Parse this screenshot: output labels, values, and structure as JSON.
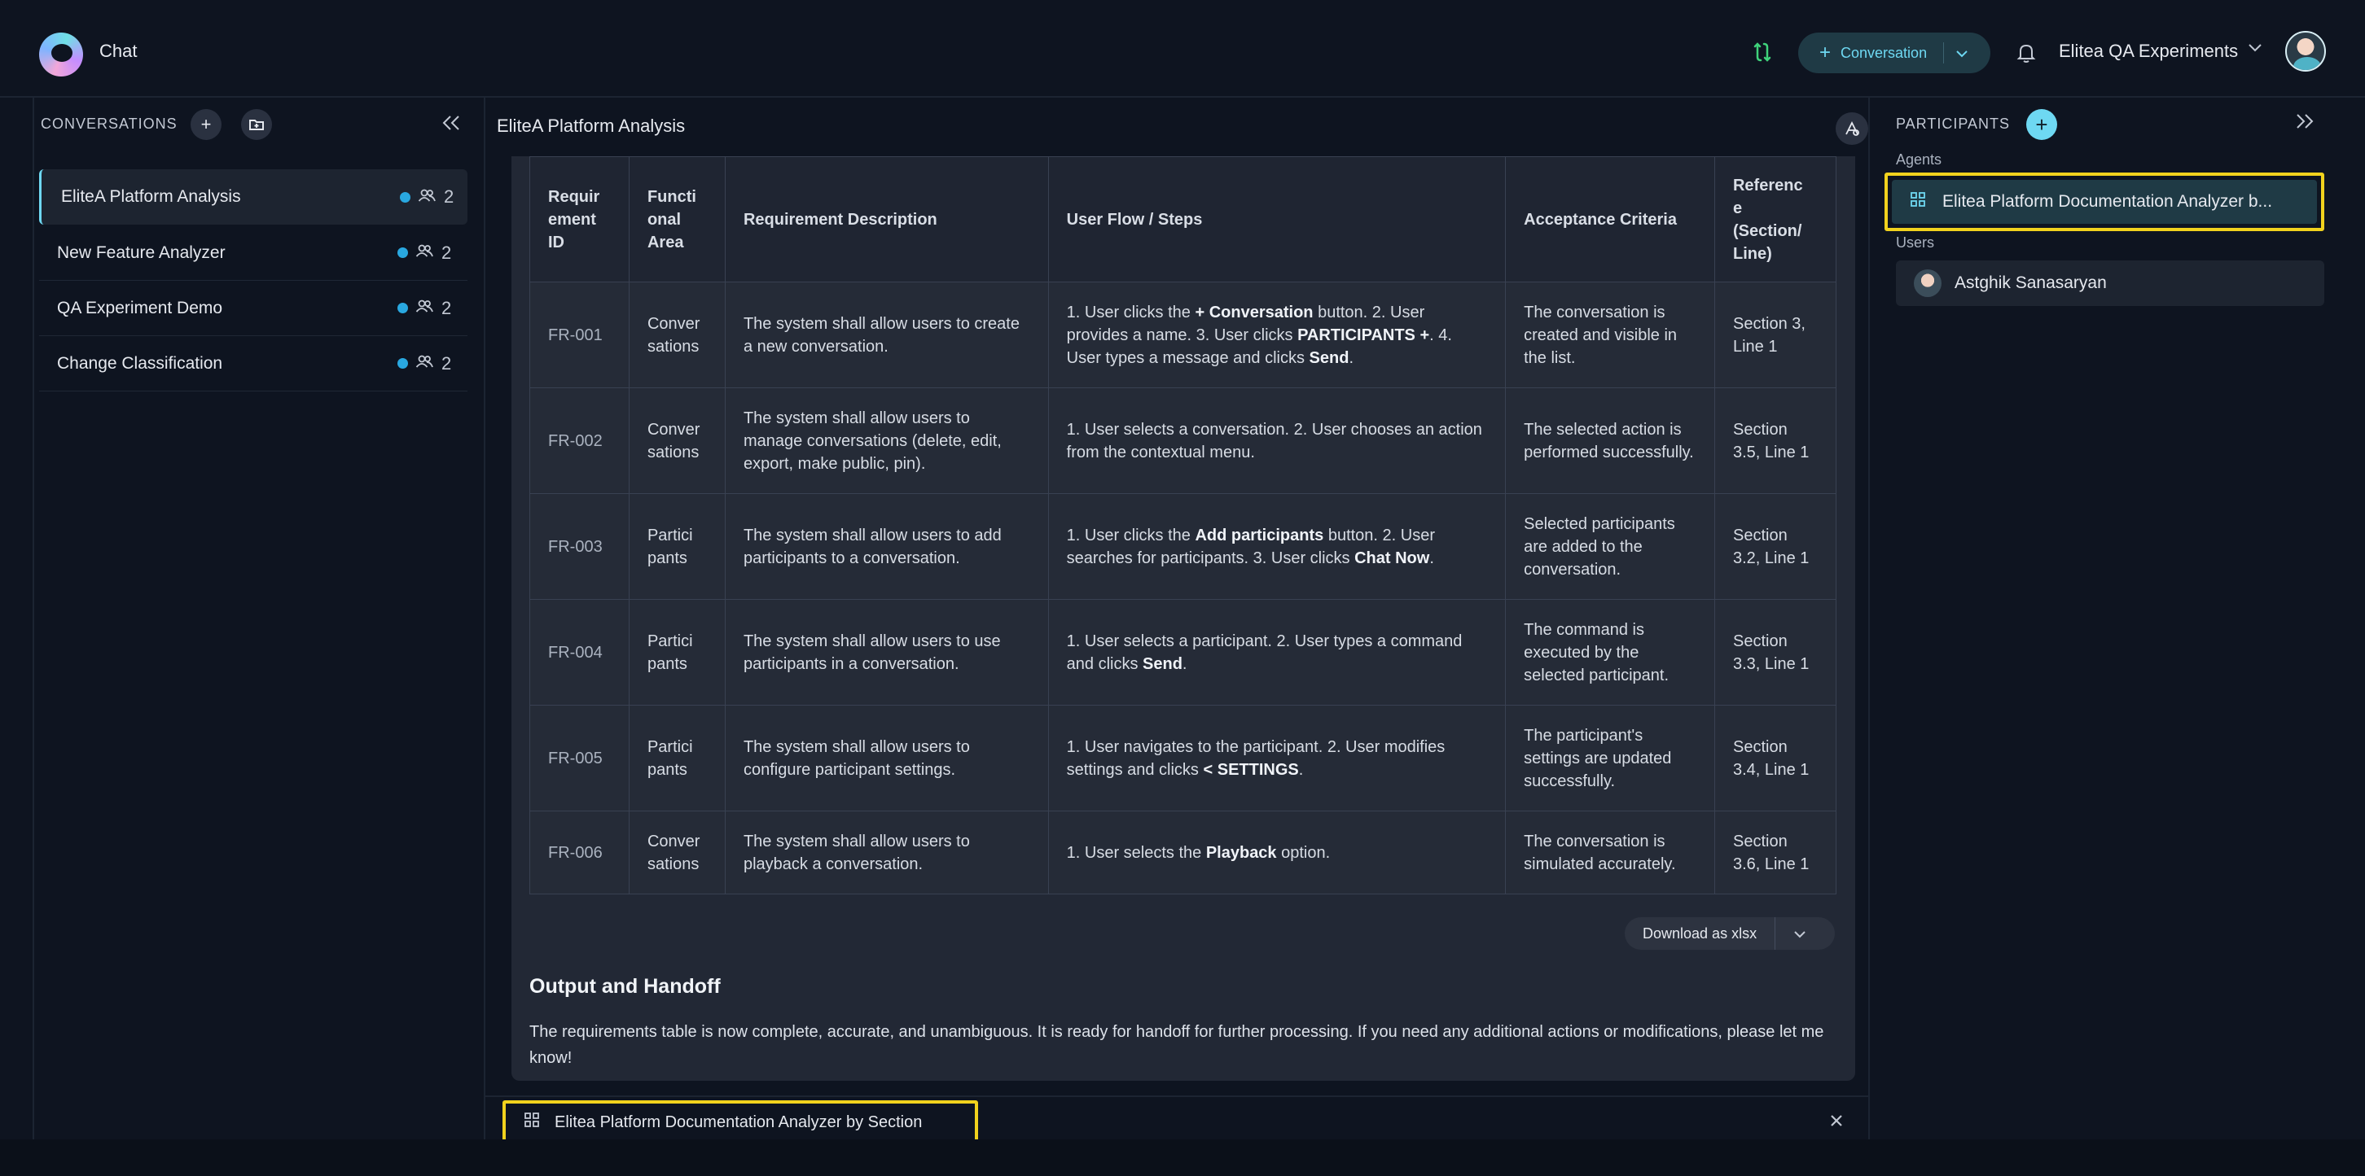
{
  "header": {
    "app_title": "Chat",
    "conversation_button_label": "Conversation",
    "project_name": "Elitea QA Experiments"
  },
  "sidebar": {
    "heading": "CONVERSATIONS",
    "items": [
      {
        "name": "EliteA Platform Analysis",
        "participants": "2"
      },
      {
        "name": "New Feature Analyzer",
        "participants": "2"
      },
      {
        "name": "QA Experiment Demo",
        "participants": "2"
      },
      {
        "name": "Change Classification",
        "participants": "2"
      }
    ]
  },
  "main": {
    "title": "EliteA Platform Analysis",
    "table": {
      "headers": [
        "Requir\nement\nID",
        "Functi\nonal\nArea",
        "Requirement Description",
        "User Flow / Steps",
        "Acceptance Criteria",
        "Referenc\ne\n(Section/\nLine)"
      ],
      "rows": [
        {
          "id": "FR-001",
          "area": "Conver\nsations",
          "description": "The system shall allow users to create a new conversation.",
          "flow": "1. User clicks the <b>+ Conversation</b> button. 2. User provides a name. 3. User clicks <b>PARTICIPANTS +</b>. 4. User types a message and clicks <b>Send</b>.",
          "criteria": "The conversation is created and visible in the list.",
          "reference": "Section 3, Line 1"
        },
        {
          "id": "FR-002",
          "area": "Conver\nsations",
          "description": "The system shall allow users to manage conversations (delete, edit, export, make public, pin).",
          "flow": "1. User selects a conversation. 2. User chooses an action from the contextual menu.",
          "criteria": "The selected action is performed successfully.",
          "reference": "Section 3.5, Line 1"
        },
        {
          "id": "FR-003",
          "area": "Partici\npants",
          "description": "The system shall allow users to add participants to a conversation.",
          "flow": "1. User clicks the <b>Add participants</b> button. 2. User searches for participants. 3. User clicks <b>Chat Now</b>.",
          "criteria": "Selected participants are added to the conversation.",
          "reference": "Section 3.2, Line 1"
        },
        {
          "id": "FR-004",
          "area": "Partici\npants",
          "description": "The system shall allow users to use participants in a conversation.",
          "flow": "1. User selects a participant. 2. User types a command and clicks <b>Send</b>.",
          "criteria": "The command is executed by the selected participant.",
          "reference": "Section 3.3, Line 1"
        },
        {
          "id": "FR-005",
          "area": "Partici\npants",
          "description": "The system shall allow users to configure participant settings.",
          "flow": "1. User navigates to the participant. 2. User modifies settings and clicks <b>&lt; SETTINGS</b>.",
          "criteria": "The participant's settings are updated successfully.",
          "reference": "Section 3.4, Line 1"
        },
        {
          "id": "FR-006",
          "area": "Conver\nsations",
          "description": "The system shall allow users to playback a conversation.",
          "flow": "1. User selects the <b>Playback</b> option.",
          "criteria": "The conversation is simulated accurately.",
          "reference": "Section 3.6, Line 1"
        }
      ]
    },
    "download_label": "Download as xlsx",
    "output_heading": "Output and Handoff",
    "output_text": "The requirements table is now complete, accurate, and unambiguous. It is ready for handoff for further processing. If you need any additional actions or modifications, please let me know!",
    "selected_agent": "Elitea Platform Documentation Analyzer by Section"
  },
  "participants": {
    "heading": "PARTICIPANTS",
    "agents_label": "Agents",
    "users_label": "Users",
    "agent_name": "Elitea Platform  Documentation Analyzer  b...",
    "user_name": "Astghik Sanasaryan"
  },
  "colors": {
    "accent": "#6ed8f2",
    "highlight": "#f1d21d",
    "status_dot": "#29a8e0",
    "background": "#0e1420"
  }
}
